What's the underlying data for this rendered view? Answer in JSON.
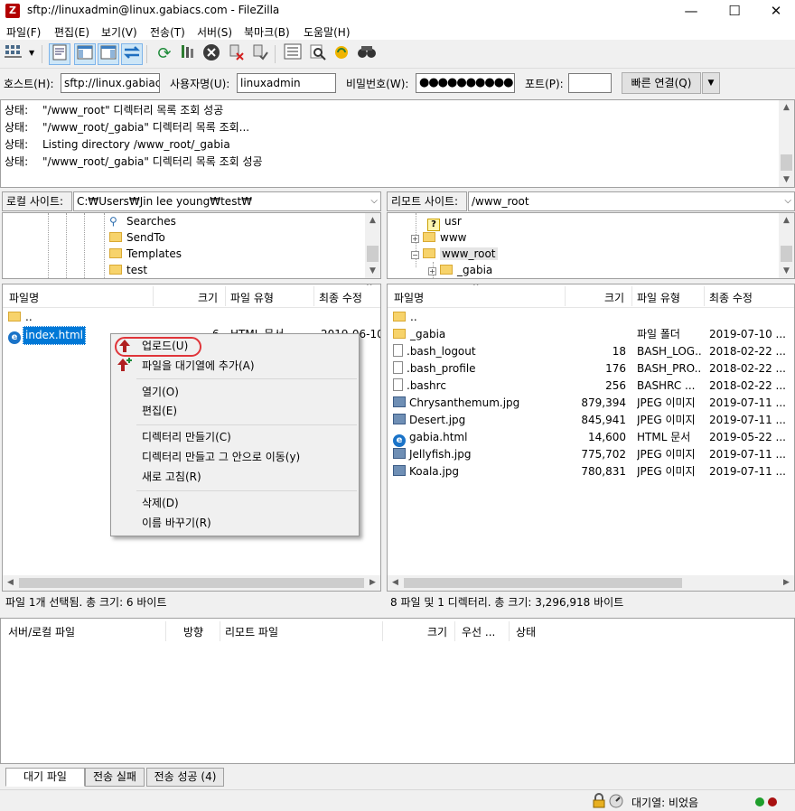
{
  "window": {
    "title": "sftp://linuxadmin@linux.gabiacs.com - FileZilla",
    "app_icon": "Z",
    "controls": {
      "minimize": "—",
      "maximize": "☐",
      "close": "✕"
    }
  },
  "menu": [
    "파일(F)",
    "편집(E)",
    "보기(V)",
    "전송(T)",
    "서버(S)",
    "북마크(B)",
    "도움말(H)"
  ],
  "toolbar_icons": [
    "site-manager-icon",
    "toggle-log-icon",
    "toggle-local-tree-icon",
    "toggle-remote-tree-icon",
    "toggle-queue-icon",
    "refresh-icon",
    "process-queue-icon",
    "cancel-icon",
    "disconnect-icon",
    "reconnect-icon",
    "filter-icon",
    "search-files-icon",
    "sync-browse-icon",
    "find-icon"
  ],
  "quickconnect": {
    "host_label": "호스트(H):",
    "host_value": "sftp://linux.gabiacs",
    "user_label": "사용자명(U):",
    "user_value": "linuxadmin",
    "pass_label": "비밀번호(W):",
    "pass_value": "●●●●●●●●●●",
    "port_label": "포트(P):",
    "port_value": "",
    "connect_button": "빠른 연결(Q)",
    "dropdown_arrow": "▼"
  },
  "log": [
    {
      "label": "상태:",
      "text": "\"/www_root\" 디렉터리 목록 조회 성공"
    },
    {
      "label": "상태:",
      "text": "\"/www_root/_gabia\" 디렉터리 목록 조회..."
    },
    {
      "label": "상태:",
      "text": "Listing directory /www_root/_gabia"
    },
    {
      "label": "상태:",
      "text": "\"/www_root/_gabia\" 디렉터리 목록 조회 성공"
    }
  ],
  "local": {
    "site_label": "로컬 사이트:",
    "path": "C:₩Users₩Jin lee young₩test₩",
    "tree": [
      "Searches",
      "SendTo",
      "Templates",
      "test"
    ],
    "columns": [
      "파일명",
      "크기",
      "파일 유형",
      "최종 수정"
    ],
    "files": [
      {
        "name": "..",
        "size": "",
        "type": "",
        "modified": ""
      },
      {
        "name": "index.html",
        "size": "6",
        "type": "HTML 문서",
        "modified": "2019-06-10"
      }
    ],
    "status": "파일 1개 선택됨. 총 크기: 6 바이트"
  },
  "remote": {
    "site_label": "리모트 사이트:",
    "path": "/www_root",
    "tree": [
      "usr",
      "www",
      "www_root",
      "_gabia"
    ],
    "columns": [
      "파일명",
      "크기",
      "파일 유형",
      "최종 수정"
    ],
    "files": [
      {
        "name": "..",
        "size": "",
        "type": "",
        "modified": "",
        "icon": "folder"
      },
      {
        "name": "_gabia",
        "size": "",
        "type": "파일 폴더",
        "modified": "2019-07-10 ...",
        "icon": "folder"
      },
      {
        "name": ".bash_logout",
        "size": "18",
        "type": "BASH_LOG...",
        "modified": "2018-02-22 ...",
        "icon": "file"
      },
      {
        "name": ".bash_profile",
        "size": "176",
        "type": "BASH_PRO...",
        "modified": "2018-02-22 ...",
        "icon": "file"
      },
      {
        "name": ".bashrc",
        "size": "256",
        "type": "BASHRC ...",
        "modified": "2018-02-22 ...",
        "icon": "file"
      },
      {
        "name": "Chrysanthemum.jpg",
        "size": "879,394",
        "type": "JPEG 이미지",
        "modified": "2019-07-11 ...",
        "icon": "image"
      },
      {
        "name": "Desert.jpg",
        "size": "845,941",
        "type": "JPEG 이미지",
        "modified": "2019-07-11 ...",
        "icon": "image"
      },
      {
        "name": "gabia.html",
        "size": "14,600",
        "type": "HTML 문서",
        "modified": "2019-05-22 ...",
        "icon": "html"
      },
      {
        "name": "Jellyfish.jpg",
        "size": "775,702",
        "type": "JPEG 이미지",
        "modified": "2019-07-11 ...",
        "icon": "image"
      },
      {
        "name": "Koala.jpg",
        "size": "780,831",
        "type": "JPEG 이미지",
        "modified": "2019-07-11 ...",
        "icon": "image"
      }
    ],
    "status": "8 파일 및 1 디렉터리. 총 크기: 3,296,918 바이트"
  },
  "context_menu": {
    "upload": "업로드(U)",
    "add_to_queue": "파일을 대기열에 추가(A)",
    "open": "열기(O)",
    "edit": "편집(E)",
    "create_dir": "디렉터리 만들기(C)",
    "create_dir_enter": "디렉터리 만들고 그 안으로 이동(y)",
    "refresh": "새로 고침(R)",
    "delete": "삭제(D)",
    "rename": "이름 바꾸기(R)"
  },
  "queue": {
    "columns": [
      "서버/로컬 파일",
      "방향",
      "리모트 파일",
      "크기",
      "우선 ...",
      "상태"
    ],
    "tabs": [
      "대기 파일",
      "전송 실패",
      "전송 성공 (4)"
    ]
  },
  "statusbar": {
    "queue_text": "대기열: 비었음",
    "colors": {
      "green": "#1f9e2c",
      "red": "#a81010"
    }
  },
  "colors": {
    "selection": "#0078d7",
    "upload_ring": "#e0353a"
  }
}
